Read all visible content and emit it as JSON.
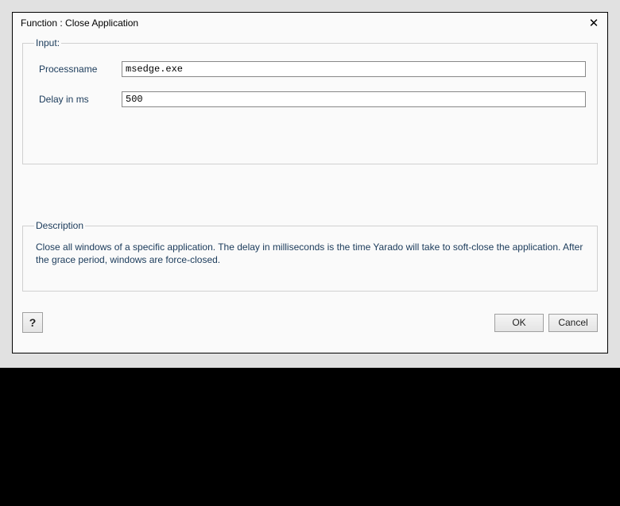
{
  "window": {
    "title": "Function : Close Application"
  },
  "input_group": {
    "legend": "Input:",
    "processname_label": "Processname",
    "processname_value": "msedge.exe",
    "delay_label": "Delay in ms",
    "delay_value": "500"
  },
  "description_group": {
    "legend": "Description",
    "text": "Close all windows of a specific application. The delay in milliseconds is the time Yarado will take to soft-close the application. After the grace period, windows are force-closed."
  },
  "buttons": {
    "help": "?",
    "ok": "OK",
    "cancel": "Cancel"
  }
}
